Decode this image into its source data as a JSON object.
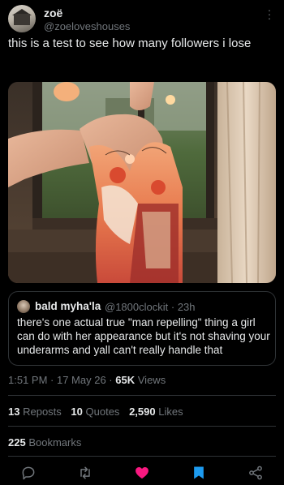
{
  "author": {
    "display_name": "zoë",
    "handle": "@zoeloveshouses"
  },
  "tweet": {
    "text": "this is a test to see how many followers i lose"
  },
  "quoted_tweet": {
    "display_name": "bald myha'la",
    "handle": "@1800clockit",
    "time": "· 23h",
    "text": "there's one actual true \"man repelling\" thing a girl can do with her appearance but it's not shaving your underarms and yall can't really handle that"
  },
  "meta": {
    "time": "1:51 PM",
    "date": "· 17 May 26 ·",
    "views_count": "65K",
    "views_label": "Views"
  },
  "stats": {
    "reposts_count": "13",
    "reposts_label": "Reposts",
    "quotes_count": "10",
    "quotes_label": "Quotes",
    "likes_count": "2,590",
    "likes_label": "Likes",
    "bookmarks_count": "225",
    "bookmarks_label": "Bookmarks"
  },
  "actions": [
    {
      "name": "reply-icon",
      "color": "#71767b"
    },
    {
      "name": "repost-icon",
      "color": "#71767b"
    },
    {
      "name": "like-icon",
      "color": "#f91880"
    },
    {
      "name": "bookmark-icon",
      "color": "#1d9bf0"
    },
    {
      "name": "share-icon",
      "color": "#71767b"
    }
  ],
  "colors": {
    "background": "#000000",
    "text": "#e7e9ea",
    "secondary": "#71767b",
    "border": "#2f3336",
    "like": "#f91880",
    "bookmark": "#1d9bf0"
  }
}
